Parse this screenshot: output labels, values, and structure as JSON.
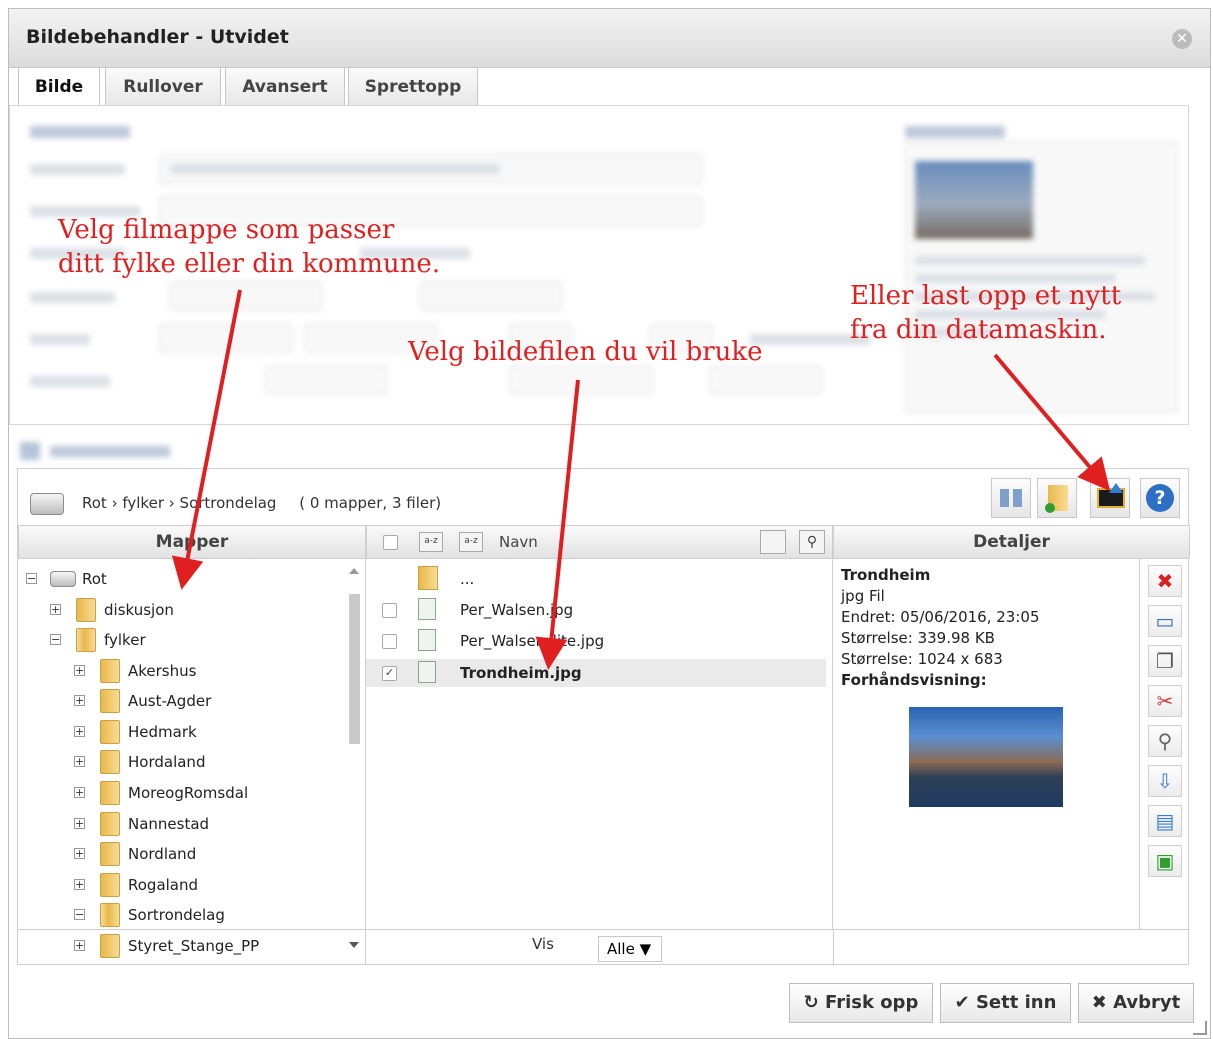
{
  "window": {
    "title": "Bildebehandler - Utvidet"
  },
  "tabs": [
    {
      "label": "Bilde",
      "active": true
    },
    {
      "label": "Rullover",
      "active": false
    },
    {
      "label": "Avansert",
      "active": false
    },
    {
      "label": "Sprettopp",
      "active": false
    }
  ],
  "breadcrumb": {
    "root": "Rot",
    "sep": "›",
    "level1": "fylker",
    "level2": "Sortrondelag",
    "count": "( 0 mapper, 3 filer)"
  },
  "columns": {
    "folders": "Mapper",
    "files_name": "Navn",
    "details": "Detaljer"
  },
  "tree": [
    {
      "label": "Rot",
      "toggle": "−",
      "depth": 0,
      "type": "drive"
    },
    {
      "label": "diskusjon",
      "toggle": "+",
      "depth": 1,
      "type": "folder"
    },
    {
      "label": "fylker",
      "toggle": "−",
      "depth": 1,
      "type": "folder-open"
    },
    {
      "label": "Akershus",
      "toggle": "+",
      "depth": 2,
      "type": "folder"
    },
    {
      "label": "Aust-Agder",
      "toggle": "+",
      "depth": 2,
      "type": "folder"
    },
    {
      "label": "Hedmark",
      "toggle": "+",
      "depth": 2,
      "type": "folder"
    },
    {
      "label": "Hordaland",
      "toggle": "+",
      "depth": 2,
      "type": "folder"
    },
    {
      "label": "MoreogRomsdal",
      "toggle": "+",
      "depth": 2,
      "type": "folder"
    },
    {
      "label": "Nannestad",
      "toggle": "+",
      "depth": 2,
      "type": "folder"
    },
    {
      "label": "Nordland",
      "toggle": "+",
      "depth": 2,
      "type": "folder"
    },
    {
      "label": "Rogaland",
      "toggle": "+",
      "depth": 2,
      "type": "folder"
    },
    {
      "label": "Sortrondelag",
      "toggle": "−",
      "depth": 2,
      "type": "folder-open"
    },
    {
      "label": "Styret_Stange_PP",
      "toggle": "+",
      "depth": 2,
      "type": "folder"
    }
  ],
  "files": [
    {
      "label": "...",
      "type": "up",
      "checked": false
    },
    {
      "label": "Per_Walsen.jpg",
      "type": "image",
      "checked": false
    },
    {
      "label": "Per_Walsen_lite.jpg",
      "type": "image",
      "checked": false
    },
    {
      "label": "Trondheim.jpg",
      "type": "image",
      "checked": true
    }
  ],
  "details": {
    "name": "Trondheim",
    "type": "jpg Fil",
    "modified": "Endret: 05/06/2016, 23:05",
    "size": "Størrelse: 339.98 KB",
    "dimensions": "Størrelse: 1024 x 683",
    "preview_label": "Forhåndsvisning:"
  },
  "filter": {
    "label": "Vis",
    "value": "Alle ▼"
  },
  "buttons": {
    "refresh": "Frisk opp",
    "insert": "Sett inn",
    "cancel": "Avbryt"
  },
  "annotations": {
    "folder_1": "Velg filmappe som passer",
    "folder_2": "ditt fylke eller din kommune.",
    "file": "Velg bildefilen du vil bruke",
    "upload_1": "Eller last opp et nytt",
    "upload_2": "fra din datamaskin."
  },
  "colors": {
    "annotation": "#e02020",
    "help": "#2c6fc4",
    "delete": "#d81e1e"
  }
}
